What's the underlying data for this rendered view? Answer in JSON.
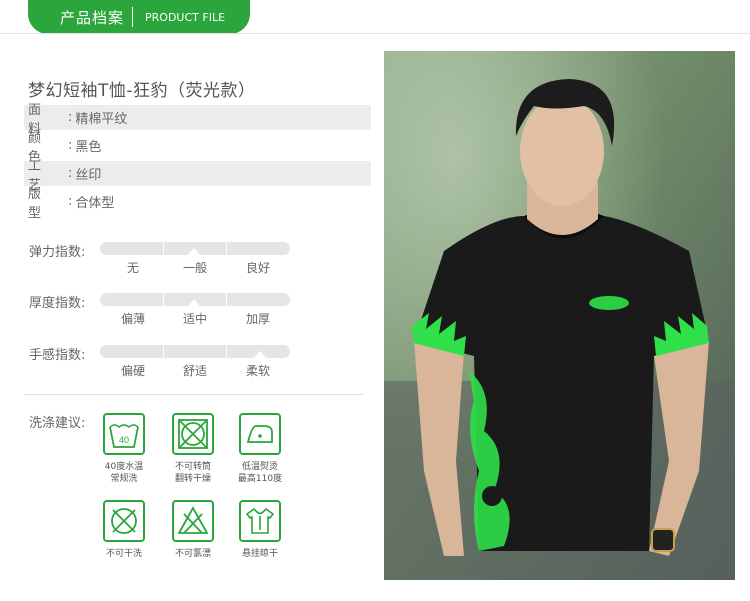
{
  "header": {
    "title_cn": "产品档案",
    "title_en": "PRODUCT FILE"
  },
  "product": {
    "title": "梦幻短袖T恤-狂豹（荧光款）"
  },
  "specs": [
    {
      "label": "面料",
      "value": "精棉平纹"
    },
    {
      "label": "颜色",
      "value": "黑色"
    },
    {
      "label": "工艺",
      "value": "丝印"
    },
    {
      "label": "版型",
      "value": "合体型"
    }
  ],
  "indices": [
    {
      "label": "弹力指数:",
      "options": [
        "无",
        "一般",
        "良好"
      ],
      "selected": "一般"
    },
    {
      "label": "厚度指数:",
      "options": [
        "偏薄",
        "适中",
        "加厚"
      ],
      "selected": "适中"
    },
    {
      "label": "手感指数:",
      "options": [
        "偏硬",
        "舒适",
        "柔软"
      ],
      "selected": "柔软"
    }
  ],
  "wash": {
    "label": "洗涤建议:",
    "items": [
      {
        "icon": "wash-40-icon",
        "line1": "40度水温",
        "line2": "常规洗",
        "icon_text": "40"
      },
      {
        "icon": "no-tumble-dry-icon",
        "line1": "不可转筒",
        "line2": "翻转干燥"
      },
      {
        "icon": "low-iron-icon",
        "line1": "低温熨烫",
        "line2": "最高110度"
      },
      {
        "icon": "no-dry-clean-icon",
        "line1": "不可干洗",
        "line2": ""
      },
      {
        "icon": "no-bleach-icon",
        "line1": "不可氯漂",
        "line2": ""
      },
      {
        "icon": "hang-dry-icon",
        "line1": "悬挂晾干",
        "line2": ""
      }
    ]
  },
  "colors": {
    "accent": "#2aa63c"
  }
}
